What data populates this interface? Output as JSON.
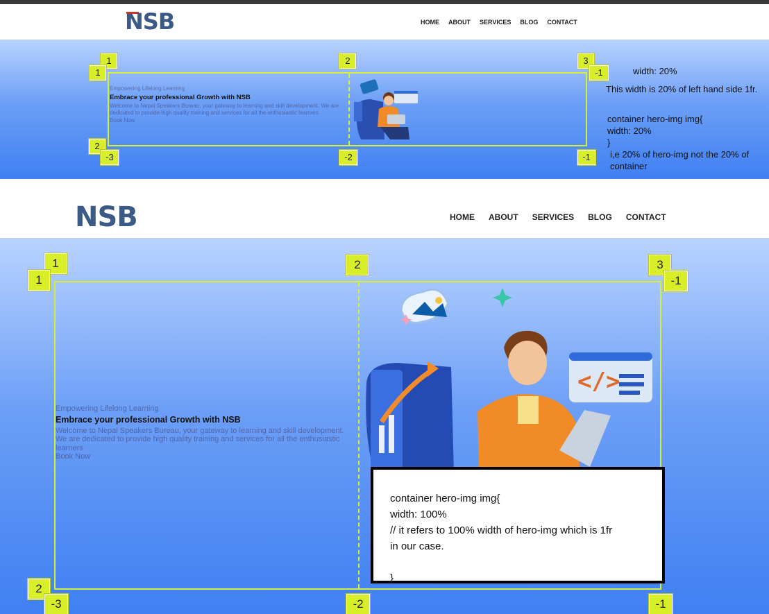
{
  "brand": {
    "logo": "NSB"
  },
  "nav": {
    "items": [
      "HOME",
      "ABOUT",
      "SERVICES",
      "BLOG",
      "CONTACT"
    ]
  },
  "hero": {
    "subtitle": "Empowering Lifelong Learning",
    "title": "Embrace your professional Growth with NSB",
    "description": "Welcome to Nepal Speakers Bureau, your gateway to learning and skill development. We are dedicated to provide high quality training and services for all the enthusiastic learners",
    "cta": "Book Now"
  },
  "grid_labels": {
    "top": [
      "1",
      "2",
      "3"
    ],
    "left": [
      "1",
      "2"
    ],
    "right": [
      "-1",
      "-1"
    ],
    "bottom": [
      "-3",
      "-2",
      "-1"
    ]
  },
  "annotations": {
    "top_width": "width: 20%",
    "top_explain": "This width is 20% of left hand side 1fr.",
    "top_code_1": "container hero-img img{",
    "top_code_2": "width: 20%",
    "top_code_3": "}",
    "top_code_4": "i,e 20% of hero-img not the 20% of",
    "top_code_5": "container",
    "bottom_code_1": "container hero-img img{",
    "bottom_code_2": "width: 100%",
    "bottom_code_3": "// it refers to 100% width of hero-img which is 1fr",
    "bottom_code_4": "in our case.",
    "bottom_code_5": "}"
  },
  "colors": {
    "accent": "#d4ef3a",
    "logo": "#3b5a86",
    "hero_top": "#b9d3ff",
    "hero_bottom": "#3f80f2"
  }
}
